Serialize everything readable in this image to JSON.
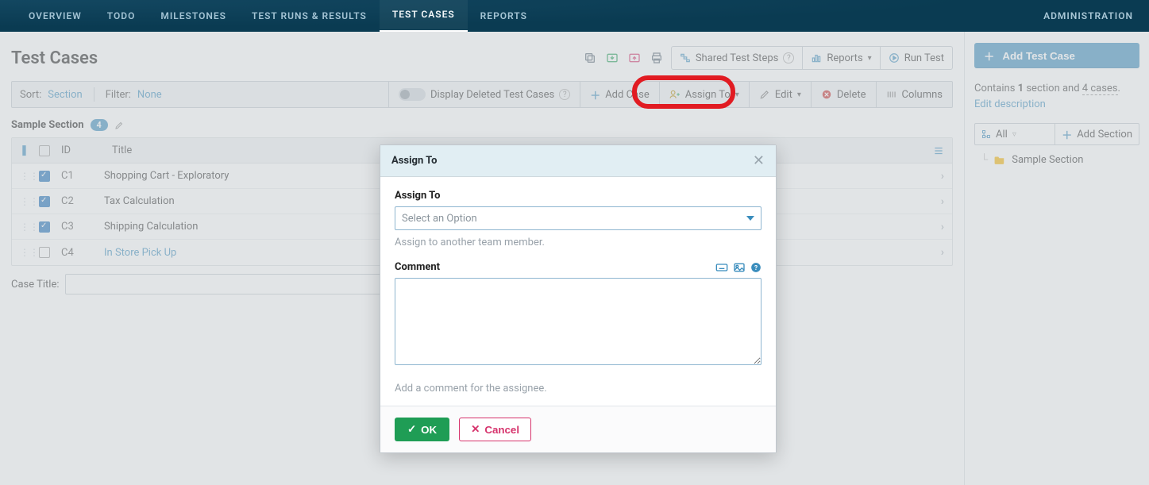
{
  "nav": {
    "items": [
      "OVERVIEW",
      "TODO",
      "MILESTONES",
      "TEST RUNS & RESULTS",
      "TEST CASES",
      "REPORTS"
    ],
    "active_index": 4,
    "admin": "ADMINISTRATION"
  },
  "header": {
    "title": "Test Cases",
    "shared_steps": "Shared Test Steps",
    "reports": "Reports",
    "run_test": "Run Test"
  },
  "toolbar": {
    "sort_label": "Sort:",
    "sort_value": "Section",
    "filter_label": "Filter:",
    "filter_value": "None",
    "display_deleted": "Display Deleted Test Cases",
    "add_case": "Add Case",
    "assign_to": "Assign To",
    "edit": "Edit",
    "delete": "Delete",
    "columns": "Columns"
  },
  "section": {
    "name": "Sample Section",
    "count": "4"
  },
  "table": {
    "head_id": "ID",
    "head_title": "Title",
    "rows": [
      {
        "checked": true,
        "id": "C1",
        "title": "Shopping Cart - Exploratory",
        "is_link": false
      },
      {
        "checked": true,
        "id": "C2",
        "title": "Tax Calculation",
        "is_link": false
      },
      {
        "checked": true,
        "id": "C3",
        "title": "Shipping Calculation",
        "is_link": false
      },
      {
        "checked": false,
        "id": "C4",
        "title": "In Store Pick Up",
        "is_link": true
      }
    ],
    "case_title_label": "Case Title:"
  },
  "sidebar": {
    "add_test_case": "Add Test Case",
    "contains_prefix": "Contains ",
    "contains_mid1": "1",
    "contains_mid2": " section and ",
    "contains_mid3": "4 cases",
    "contains_suffix": ". ",
    "edit_desc": "Edit description",
    "tree_all": "All",
    "add_section": "Add Section",
    "tree_item": "Sample Section"
  },
  "modal": {
    "title": "Assign To",
    "assign_label": "Assign To",
    "select_placeholder": "Select an Option",
    "assign_help": "Assign to another team member.",
    "comment_label": "Comment",
    "comment_help": "Add a comment for the assignee.",
    "ok": "OK",
    "cancel": "Cancel"
  }
}
